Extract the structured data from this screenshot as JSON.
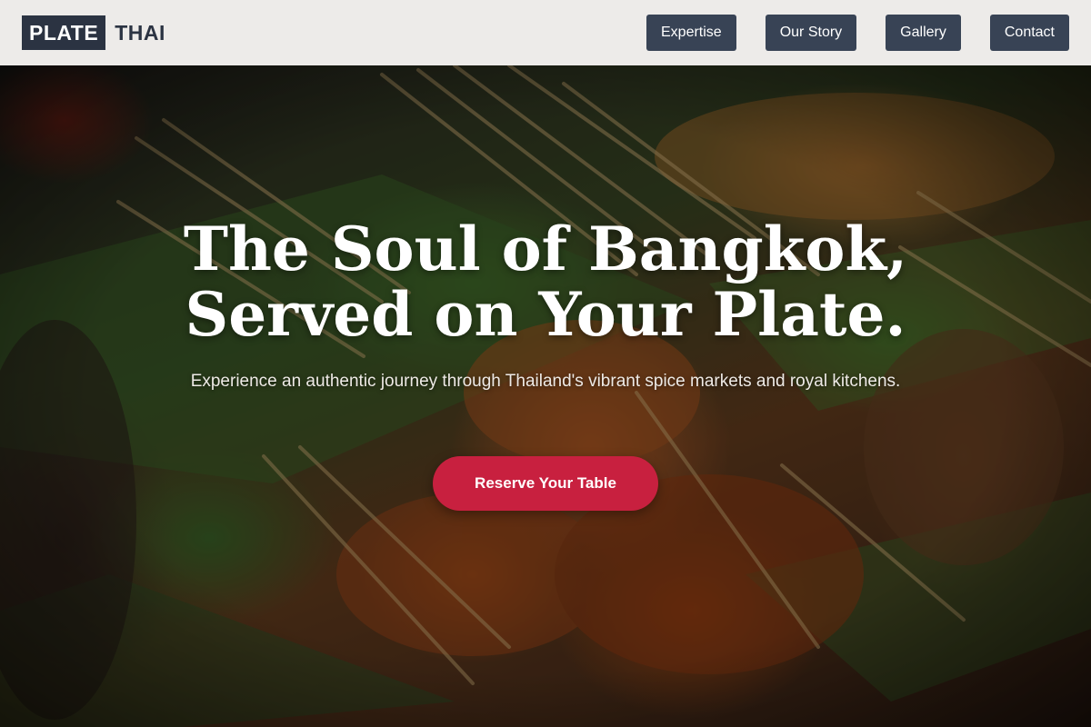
{
  "brand": {
    "logo_box": "PLATE",
    "logo_word": "THAI"
  },
  "nav": {
    "items": [
      {
        "label": "Expertise"
      },
      {
        "label": "Our Story"
      },
      {
        "label": "Gallery"
      },
      {
        "label": "Contact"
      }
    ]
  },
  "hero": {
    "title_line1": "The Soul of Bangkok,",
    "title_line2": "Served on Your Plate.",
    "subtitle": "Experience an authentic journey through Thailand's vibrant spice markets and royal kitchens.",
    "cta_label": "Reserve Your Table",
    "background_image": "grilled-skewers-on-banana-leaves"
  },
  "colors": {
    "header_bg": "#f6f5f3",
    "nav_button_bg": "#384355",
    "logo_box_bg": "#2b3342",
    "cta_bg": "#c8203f",
    "text_light": "#ffffff"
  }
}
